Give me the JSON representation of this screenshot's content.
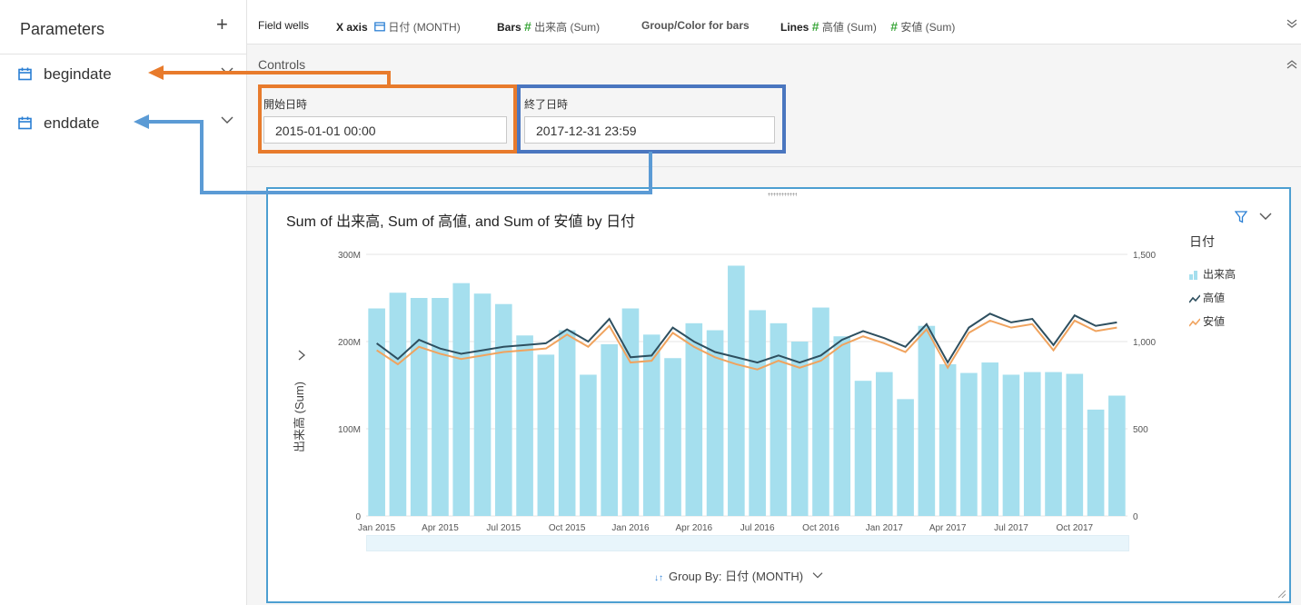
{
  "sidebar": {
    "title": "Parameters",
    "add_label": "+",
    "params": [
      {
        "name": "begindate"
      },
      {
        "name": "enddate"
      }
    ]
  },
  "fieldwells": {
    "label": "Field wells",
    "xaxis_label": "X axis",
    "xaxis_value": "日付 (MONTH)",
    "bars_label": "Bars",
    "bars_value": "出来高 (Sum)",
    "group_label": "Group/Color for bars",
    "lines_label": "Lines",
    "lines_value1": "高値 (Sum)",
    "lines_value2": "安値 (Sum)"
  },
  "controls": {
    "label": "Controls",
    "begin": {
      "label": "開始日時",
      "value": "2015-01-01 00:00"
    },
    "end": {
      "label": "終了日時",
      "value": "2017-12-31 23:59"
    }
  },
  "visual": {
    "title": "Sum of 出来高, Sum of 高値, and Sum of 安値 by 日付",
    "legend_title": "日付",
    "legend": [
      "出来高",
      "高値",
      "安値"
    ],
    "y_label": "出来高 (Sum)",
    "group_by": "Group By: 日付 (MONTH)"
  },
  "colors": {
    "bar": "#a5dfee",
    "high": "#2e4f5f",
    "low": "#f0a35e",
    "orange_annot": "#e87b2c",
    "blue_annot": "#4a76bf",
    "light_blue_annot": "#5b9bd5",
    "accent": "#4d9fd1"
  },
  "chart_data": {
    "type": "bar",
    "categories": [
      "Jan 2015",
      "Feb 2015",
      "Mar 2015",
      "Apr 2015",
      "May 2015",
      "Jun 2015",
      "Jul 2015",
      "Aug 2015",
      "Sep 2015",
      "Oct 2015",
      "Nov 2015",
      "Dec 2015",
      "Jan 2016",
      "Feb 2016",
      "Mar 2016",
      "Apr 2016",
      "May 2016",
      "Jun 2016",
      "Jul 2016",
      "Aug 2016",
      "Sep 2016",
      "Oct 2016",
      "Nov 2016",
      "Dec 2016",
      "Jan 2017",
      "Feb 2017",
      "Mar 2017",
      "Apr 2017",
      "May 2017",
      "Jun 2017",
      "Jul 2017",
      "Aug 2017",
      "Sep 2017",
      "Oct 2017",
      "Nov 2017",
      "Dec 2017"
    ],
    "x_tick_labels": [
      "Jan 2015",
      "Apr 2015",
      "Jul 2015",
      "Oct 2015",
      "Jan 2016",
      "Apr 2016",
      "Jul 2016",
      "Oct 2016",
      "Jan 2017",
      "Apr 2017",
      "Jul 2017",
      "Oct 2017"
    ],
    "series": [
      {
        "name": "出来高",
        "axis": "left",
        "values": [
          238,
          256,
          250,
          250,
          267,
          255,
          243,
          207,
          185,
          213,
          162,
          197,
          238,
          208,
          181,
          221,
          213,
          287,
          236,
          221,
          200,
          239,
          206,
          155,
          165,
          134,
          218,
          174,
          164,
          176,
          162,
          165,
          165,
          163,
          122,
          138
        ]
      },
      {
        "name": "高値",
        "axis": "right",
        "type": "line",
        "values": [
          990,
          900,
          1010,
          960,
          930,
          950,
          970,
          980,
          990,
          1070,
          1000,
          1130,
          910,
          920,
          1080,
          1000,
          940,
          910,
          880,
          920,
          880,
          920,
          1010,
          1060,
          1020,
          970,
          1100,
          880,
          1080,
          1160,
          1110,
          1130,
          980,
          1150,
          1090,
          1110
        ]
      },
      {
        "name": "安値",
        "axis": "right",
        "type": "line",
        "values": [
          950,
          870,
          970,
          930,
          900,
          920,
          940,
          950,
          960,
          1040,
          970,
          1090,
          880,
          890,
          1050,
          970,
          910,
          870,
          840,
          890,
          850,
          890,
          980,
          1030,
          990,
          940,
          1070,
          850,
          1050,
          1120,
          1080,
          1100,
          950,
          1120,
          1060,
          1080
        ]
      }
    ],
    "ylim": [
      0,
      300
    ],
    "y_ticks": [
      "0",
      "100M",
      "200M",
      "300M"
    ],
    "y2lim": [
      0,
      1500
    ],
    "y2_ticks": [
      "0",
      "500",
      "1,000",
      "1,500"
    ],
    "ylabel": "出来高 (Sum)",
    "grid": true,
    "legend_position": "right"
  }
}
